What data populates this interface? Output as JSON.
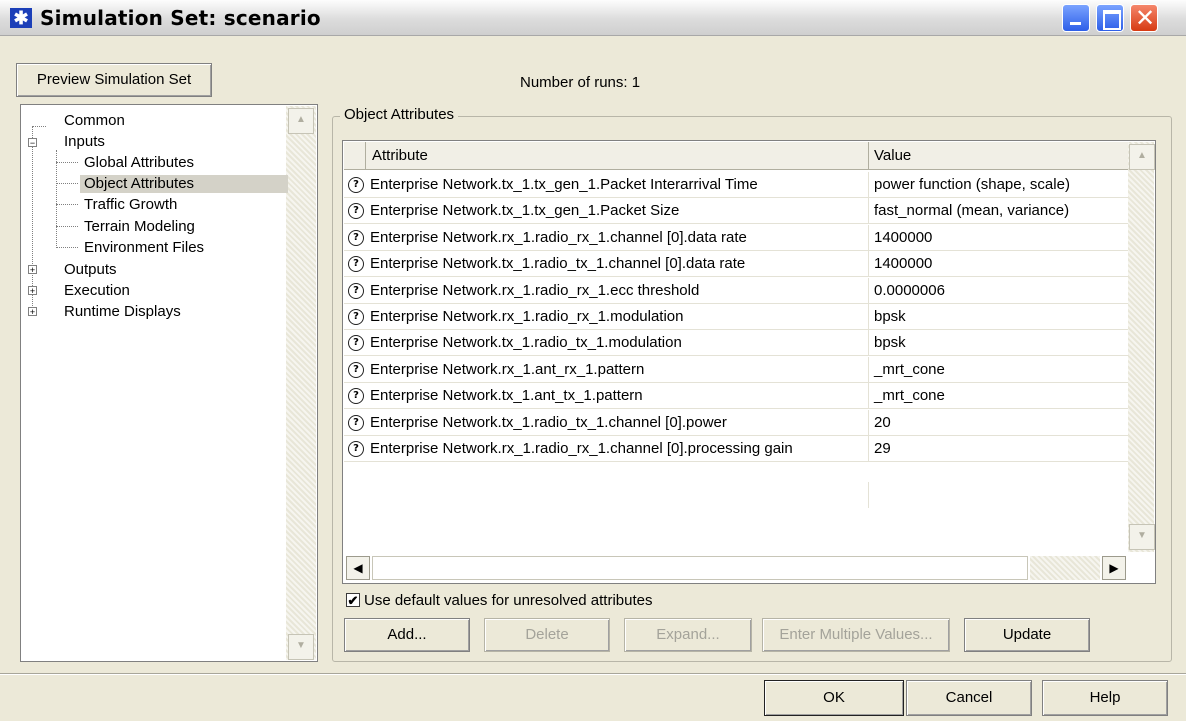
{
  "window": {
    "title": "Simulation Set: scenario",
    "app_icon": "star-icon"
  },
  "toolbar": {
    "preview_label": "Preview Simulation Set",
    "runs_label": "Number of runs: 1"
  },
  "tree": {
    "items": [
      {
        "label": "Common"
      },
      {
        "label": "Inputs"
      },
      {
        "label": "Global Attributes"
      },
      {
        "label": "Object Attributes"
      },
      {
        "label": "Traffic Growth"
      },
      {
        "label": "Terrain Modeling"
      },
      {
        "label": "Environment Files"
      },
      {
        "label": "Outputs"
      },
      {
        "label": "Execution"
      },
      {
        "label": "Runtime Displays"
      }
    ]
  },
  "object_attributes": {
    "group_title": "Object Attributes",
    "columns": {
      "attribute": "Attribute",
      "value": "Value"
    },
    "rows": [
      {
        "attribute": "Enterprise Network.tx_1.tx_gen_1.Packet Interarrival Time",
        "value": "power function (shape, scale)"
      },
      {
        "attribute": "Enterprise Network.tx_1.tx_gen_1.Packet Size",
        "value": "fast_normal (mean, variance)"
      },
      {
        "attribute": "Enterprise Network.rx_1.radio_rx_1.channel [0].data rate",
        "value": "1400000"
      },
      {
        "attribute": "Enterprise Network.tx_1.radio_tx_1.channel [0].data rate",
        "value": "1400000"
      },
      {
        "attribute": "Enterprise Network.rx_1.radio_rx_1.ecc threshold",
        "value": "0.0000006"
      },
      {
        "attribute": "Enterprise Network.rx_1.radio_rx_1.modulation",
        "value": "bpsk"
      },
      {
        "attribute": "Enterprise Network.tx_1.radio_tx_1.modulation",
        "value": "bpsk"
      },
      {
        "attribute": "Enterprise Network.rx_1.ant_rx_1.pattern",
        "value": "_mrt_cone"
      },
      {
        "attribute": "Enterprise Network.tx_1.ant_tx_1.pattern",
        "value": "_mrt_cone"
      },
      {
        "attribute": "Enterprise Network.tx_1.radio_tx_1.channel [0].power",
        "value": "20"
      },
      {
        "attribute": "Enterprise Network.rx_1.radio_rx_1.channel [0].processing gain",
        "value": "29"
      }
    ],
    "use_defaults_label": "Use default values for unresolved attributes",
    "use_defaults_checked": true,
    "buttons": {
      "add": "Add...",
      "delete": "Delete",
      "expand": "Expand...",
      "enter_multiple": "Enter Multiple Values...",
      "update": "Update"
    }
  },
  "footer": {
    "ok": "OK",
    "cancel": "Cancel",
    "help": "Help"
  }
}
